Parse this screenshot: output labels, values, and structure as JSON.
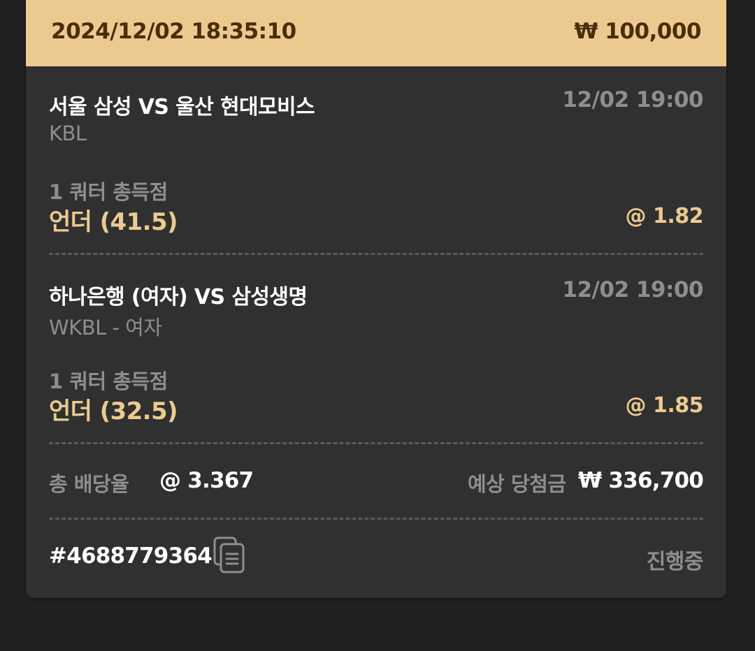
{
  "bet": {
    "placed_at": "2024/12/02 18:35:10",
    "stake": "₩ 100,000"
  },
  "selections": [
    {
      "match": "서울 삼성 VS 울산 현대모비스",
      "league": "KBL",
      "kickoff": "12/02 19:00",
      "market": "1 쿼터 총득점",
      "pick": "언더 (41.5)",
      "odds": "@ 1.82"
    },
    {
      "match": "하나은행 (여자) VS 삼성생명",
      "league": "WKBL - 여자",
      "kickoff": "12/02 19:00",
      "market": "1 쿼터 총득점",
      "pick": "언더 (32.5)",
      "odds": "@ 1.85"
    }
  ],
  "summary": {
    "total_odds_label": "총 배당율",
    "total_odds_value": "@ 3.367",
    "expected_win_label": "예상 당첨금",
    "expected_win_value": "₩ 336,700"
  },
  "footer": {
    "ticket_id": "#4688779364",
    "copy_icon": "copy-icon",
    "status": "진행중"
  },
  "colors": {
    "background": "#212121",
    "card": "#303030",
    "header": "#ecca8f",
    "header_text": "#4a2e0b",
    "accent": "#ecca8f",
    "muted": "#8e8e8e"
  }
}
